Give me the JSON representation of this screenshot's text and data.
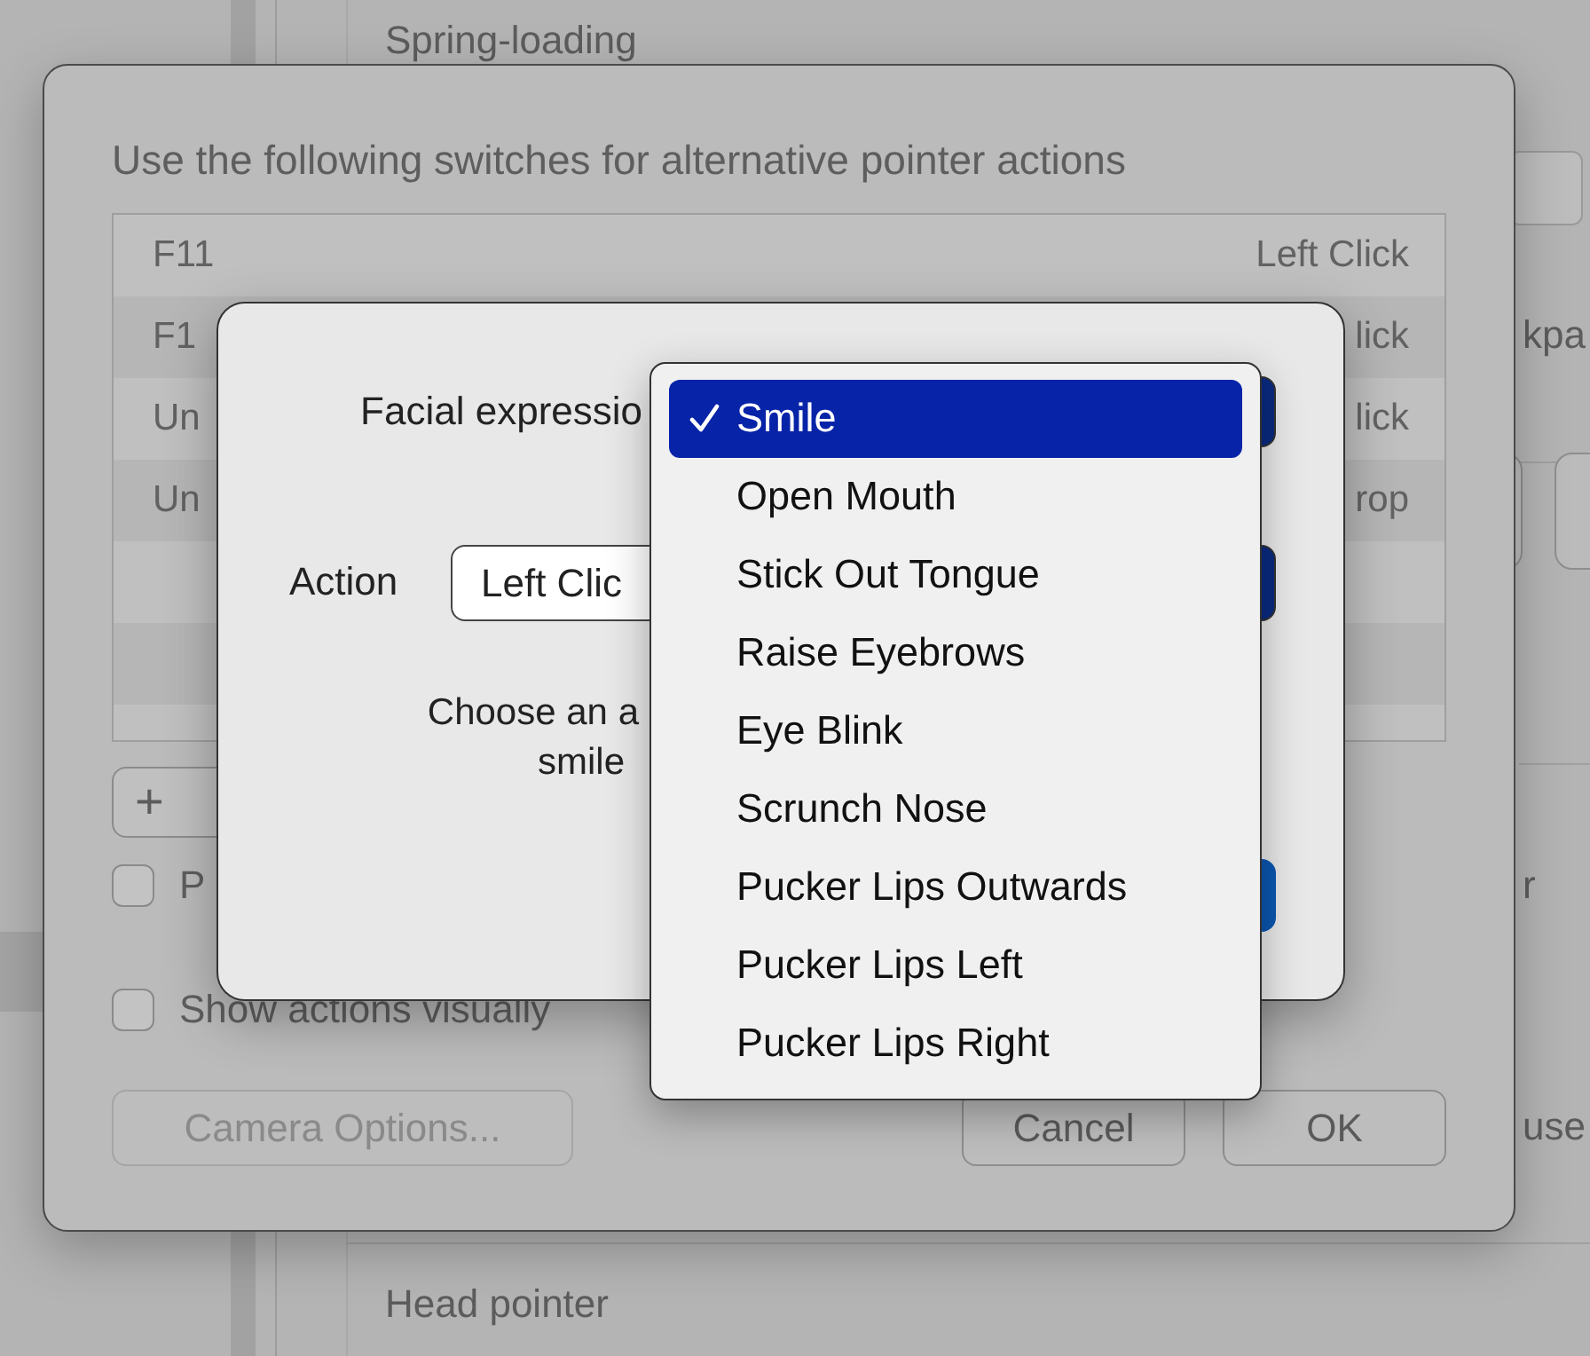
{
  "background": {
    "section_titles": [
      "Spring-loading",
      "Head pointer"
    ],
    "right_texts": [
      "kpa",
      "r",
      "use"
    ]
  },
  "sheet": {
    "title": "Use the following switches for alternative pointer actions",
    "switches": [
      {
        "switch": "F11",
        "action": "Left Click"
      },
      {
        "switch": "F1",
        "action": "lick"
      },
      {
        "switch": "Un",
        "action": "lick"
      },
      {
        "switch": "Un",
        "action": "rop"
      }
    ],
    "add_button": "+",
    "checkboxes": [
      {
        "label": "P",
        "checked": false
      },
      {
        "label": "Show actions visually",
        "checked": false
      }
    ],
    "camera_button": {
      "label": "Camera Options...",
      "disabled": true
    },
    "buttons": [
      "Cancel",
      "OK"
    ]
  },
  "dialog": {
    "facial_label": "Facial expressio",
    "action_label": "Action",
    "action_value": "Left Clic",
    "hint_lines": [
      "Choose an a",
      "smile"
    ]
  },
  "menu": {
    "items": [
      {
        "label": "Smile",
        "selected": true
      },
      {
        "label": "Open Mouth",
        "selected": false
      },
      {
        "label": "Stick Out Tongue",
        "selected": false
      },
      {
        "label": "Raise Eyebrows",
        "selected": false
      },
      {
        "label": "Eye Blink",
        "selected": false
      },
      {
        "label": "Scrunch Nose",
        "selected": false
      },
      {
        "label": "Pucker Lips Outwards",
        "selected": false
      },
      {
        "label": "Pucker Lips Left",
        "selected": false
      },
      {
        "label": "Pucker Lips Right",
        "selected": false
      }
    ]
  }
}
